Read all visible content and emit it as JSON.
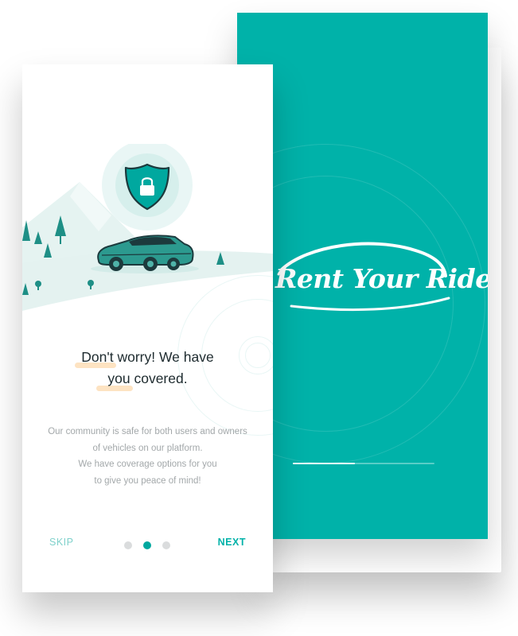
{
  "splash": {
    "logo_text": "Rent Your Ride",
    "progress": 0.44
  },
  "onboarding": {
    "headline_line1_pre": "",
    "headline_line1_hl": "Don't",
    "headline_line1_post": " worry! We have",
    "headline_line2_hl": "you",
    "headline_line2_post": " covered.",
    "body_lines": [
      "Our community is safe for both users and owners",
      "of vehicles on our platform.",
      "We have coverage options for you",
      "to give you peace of mind!"
    ],
    "skip_label": "SKIP",
    "next_label": "NEXT",
    "page_count": 3,
    "active_page": 2
  },
  "colors": {
    "brand_teal": "#00b2a9",
    "dark_teal": "#1c6b66",
    "highlight": "#fde3c2"
  },
  "icons": {
    "shield": "shield-lock-icon",
    "car": "sports-car-icon",
    "tree": "pine-tree-icon"
  }
}
